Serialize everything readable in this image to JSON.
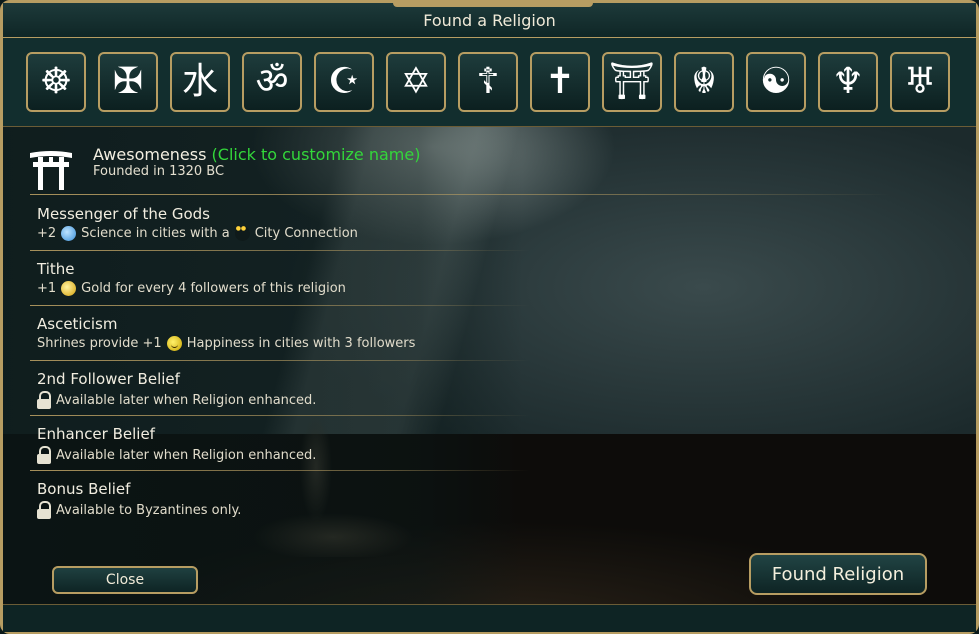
{
  "window": {
    "title": "Found a Religion"
  },
  "religion_icons": [
    {
      "name": "dharma-wheel-icon",
      "glyph": "☸"
    },
    {
      "name": "cross-pattee-icon",
      "glyph": "✠"
    },
    {
      "name": "water-kanji-icon",
      "glyph": "水"
    },
    {
      "name": "om-icon",
      "glyph": "ॐ"
    },
    {
      "name": "crescent-star-icon",
      "glyph": "☪"
    },
    {
      "name": "star-of-david-icon",
      "glyph": "✡"
    },
    {
      "name": "orthodox-cross-icon",
      "glyph": "☦"
    },
    {
      "name": "latin-cross-icon",
      "glyph": "✝"
    },
    {
      "name": "torii-icon",
      "glyph": "⛩"
    },
    {
      "name": "khanda-icon",
      "glyph": "☬"
    },
    {
      "name": "yin-yang-icon",
      "glyph": "☯"
    },
    {
      "name": "thunderbird-icon",
      "glyph": "♆"
    },
    {
      "name": "faravahar-icon",
      "glyph": "♅"
    }
  ],
  "religion": {
    "name": "Awesomeness",
    "customize_hint": "(Click to customize name)",
    "founded": "Founded in 1320 BC"
  },
  "beliefs": [
    {
      "title": "Messenger of the Gods",
      "prefix": "+2",
      "text1": "Science in cities with a",
      "text2": "City Connection"
    },
    {
      "title": "Tithe",
      "prefix": "+1",
      "text1": "Gold for every 4 followers of this religion"
    },
    {
      "title": "Asceticism",
      "prefix": "Shrines provide +1",
      "text1": "Happiness in cities with 3 followers"
    },
    {
      "title": "2nd Follower Belief",
      "text1": "Available later when Religion enhanced."
    },
    {
      "title": "Enhancer Belief",
      "text1": "Available later when Religion enhanced."
    },
    {
      "title": "Bonus Belief",
      "text1": "Available to Byzantines only."
    }
  ],
  "buttons": {
    "close": "Close",
    "found": "Found Religion"
  },
  "colors": {
    "accent_gold": "#b79d62",
    "customize_green": "#33d63a",
    "panel": "#0e2424"
  }
}
